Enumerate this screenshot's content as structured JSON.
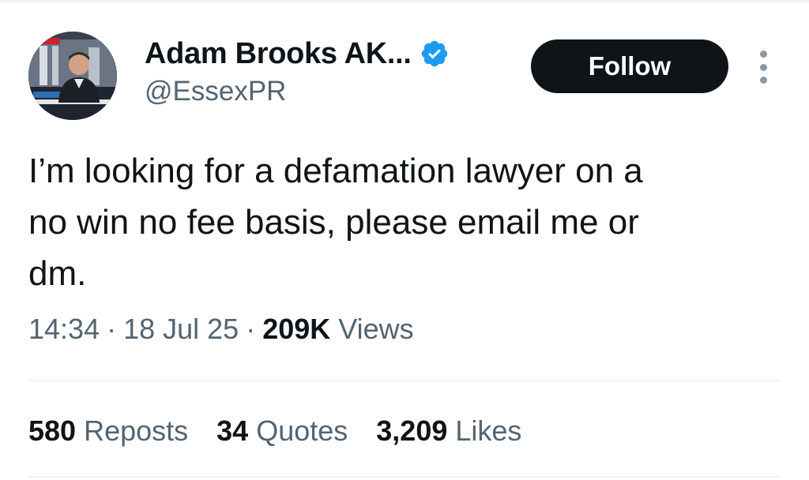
{
  "colors": {
    "text_primary": "#0f1419",
    "text_secondary": "#536471",
    "verified_badge": "#1d9bf0",
    "follow_button_bg": "#0f1419",
    "follow_button_text": "#ffffff",
    "divider": "#eff3f4"
  },
  "author": {
    "display_name": "Adam Brooks AK...",
    "handle": "@EssexPR",
    "verified_icon": "verified-badge-icon",
    "avatar_icon": "profile-photo"
  },
  "actions": {
    "follow_label": "Follow",
    "more_icon": "more-options-icon"
  },
  "tweet": {
    "text": "I’m looking for a defamation lawyer on a\nno win no fee basis, please email me or\ndm.",
    "time": "14:34",
    "separator": "·",
    "date": "18 Jul 25",
    "views_count": "209K",
    "views_label": "Views"
  },
  "stats": {
    "reposts_count": "580",
    "reposts_label": "Reposts",
    "quotes_count": "34",
    "quotes_label": "Quotes",
    "likes_count": "3,209",
    "likes_label": "Likes"
  }
}
